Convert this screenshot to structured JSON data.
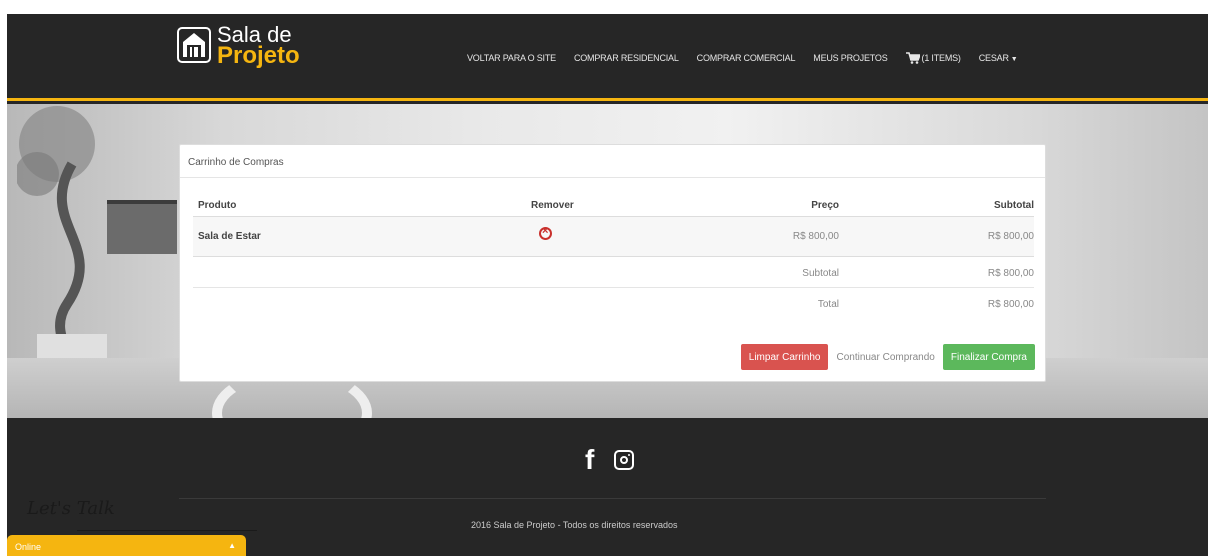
{
  "brand": {
    "line1": "Sala de",
    "line2": "Projeto"
  },
  "nav": {
    "items": [
      "VOLTAR PARA O SITE",
      "COMPRAR RESIDENCIAL",
      "COMPRAR COMERCIAL",
      "MEUS PROJETOS"
    ],
    "cart_label": "(1 ITEMS)",
    "user_label": "CESAR"
  },
  "cart": {
    "heading": "Carrinho de Compras",
    "columns": [
      "Produto",
      "Remover",
      "Preço",
      "Subtotal"
    ],
    "items": [
      {
        "product": "Sala de Estar",
        "price": "R$ 800,00",
        "subtotal": "R$ 800,00"
      }
    ],
    "subtotal_label": "Subtotal",
    "subtotal_value": "R$ 800,00",
    "total_label": "Total",
    "total_value": "R$ 800,00",
    "buttons": {
      "clear": "Limpar Carrinho",
      "continue": "Continuar Comprando",
      "checkout": "Finalizar Compra"
    }
  },
  "footer": {
    "copyright": "2016 Sala de Projeto - Todos os direitos reservados",
    "signature": "Let's Talk"
  },
  "chat": {
    "label": "Online"
  },
  "colors": {
    "accent": "#f5b510",
    "dark": "#262626",
    "danger": "#d9534f",
    "success": "#5cb85c"
  }
}
